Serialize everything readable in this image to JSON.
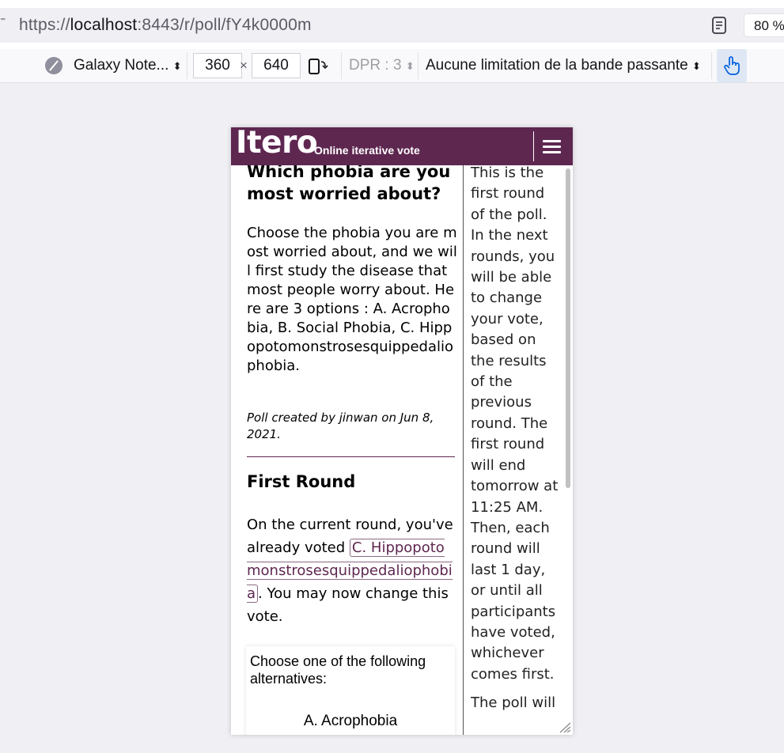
{
  "browser": {
    "url_prefix": "https://",
    "url_host": "localhost",
    "url_rest": ":8443/r/poll/fY4k0000m",
    "zoom": "80 %"
  },
  "rdm": {
    "device": "Galaxy Note...",
    "width": "360",
    "times": "×",
    "height": "640",
    "dpr": "DPR : 3",
    "throttling": "Aucune limitation de la bande passante"
  },
  "app": {
    "logo": "Itero",
    "tagline": "Online iterative vote"
  },
  "poll": {
    "title": "Which phobia are you most worried about?",
    "description": "Choose the phobia you are most worried about, and we will first study the disease that most people worry about. Here are 3 options : A. Acrophobia, B. Social Phobia, C. Hippopotomonstrosesquippedaliophobia.",
    "meta": "Poll created by jinwan on Jun 8, 2021."
  },
  "round": {
    "title": "First Round",
    "text_before": "On the current round, you've already voted ",
    "voted": "C. Hippopotomonstrosesquippedaliophobia",
    "text_after": ". You may now change this vote."
  },
  "alternatives": {
    "prompt": "Choose one of the following alternatives:",
    "options": [
      "A. Acrophobia"
    ]
  },
  "info": {
    "paragraph1": "This is the first round of the poll. In the next rounds, you will be able to change your vote, based on the results of the previous round. The first round will end tomorrow at 11:25 AM. Then, each round will last 1 day, or until all participants have voted, whichever comes first.",
    "paragraph2": "The poll will"
  },
  "colors": {
    "brand": "#5e2750",
    "touch_active": "#0060df"
  }
}
